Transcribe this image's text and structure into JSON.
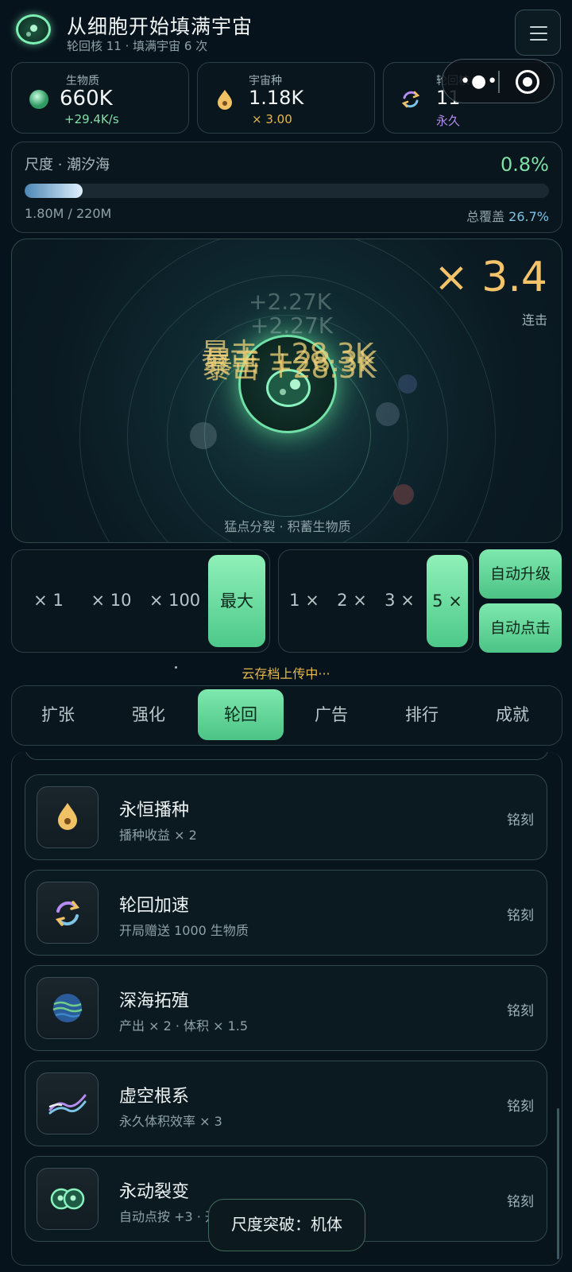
{
  "app": {
    "title": "从细胞开始填满宇宙",
    "subtitle": "轮回核 11 · 填满宇宙 6 次"
  },
  "stats": {
    "biomass": {
      "label": "生物质",
      "value": "660K",
      "sub": "+29.4K/s",
      "icon": "biomass-orb-icon",
      "color": "#7fe0a8"
    },
    "seed": {
      "label": "宇宙种",
      "value": "1.18K",
      "sub": "× 3.00",
      "icon": "seed-drop-icon",
      "color": "#e4b94e"
    },
    "core": {
      "label": "轮回核",
      "value": "11",
      "sub": "永久",
      "icon": "cycle-icon",
      "color": "#b58cf0"
    }
  },
  "scale": {
    "name": "尺度 · 潮汐海",
    "percent": "0.8%",
    "progress": 0.008,
    "amount": "1.80M / 220M",
    "coverage_label": "总覆盖",
    "coverage_value": "26.7%"
  },
  "game": {
    "combo": "× 3.4",
    "combo_label": "连击",
    "floats": [
      "+2.27K",
      "+2.27K"
    ],
    "crit_texts": [
      "暴击 +28.3K",
      "暴击 +28.3K",
      "暴击 +28.3K"
    ],
    "hint": "猛点分裂 · 积蓄生物质"
  },
  "buy_multipliers": {
    "options": [
      "× 1",
      "× 10",
      "× 100",
      "最大"
    ],
    "selected": "最大"
  },
  "speed_multipliers": {
    "options": [
      "1 ×",
      "2 ×",
      "3 ×",
      "5 ×"
    ],
    "selected": "5 ×"
  },
  "auto_buttons": {
    "upgrade": "自动升级",
    "tap": "自动点击"
  },
  "cloud_status": "云存档上传中···",
  "tabs": {
    "items": [
      "扩张",
      "强化",
      "轮回",
      "广告",
      "排行",
      "成就"
    ],
    "active": "轮回"
  },
  "list": {
    "items": [
      {
        "name": "永恒播种",
        "desc": "播种收益 × 2",
        "action": "铭刻",
        "icon": "seed-drop-icon"
      },
      {
        "name": "轮回加速",
        "desc": "开局赠送 1000 生物质",
        "action": "铭刻",
        "icon": "cycle-icon"
      },
      {
        "name": "深海拓殖",
        "desc": "产出 × 2 · 体积 × 1.5",
        "action": "铭刻",
        "icon": "ocean-planet-icon"
      },
      {
        "name": "虚空根系",
        "desc": "永久体积效率 × 3",
        "action": "铭刻",
        "icon": "root-waves-icon"
      },
      {
        "name": "永动裂变",
        "desc": "自动点按 +3 · 开",
        "action": "铭刻",
        "icon": "twin-cells-icon"
      }
    ]
  },
  "toast": "尺度突破：机体"
}
